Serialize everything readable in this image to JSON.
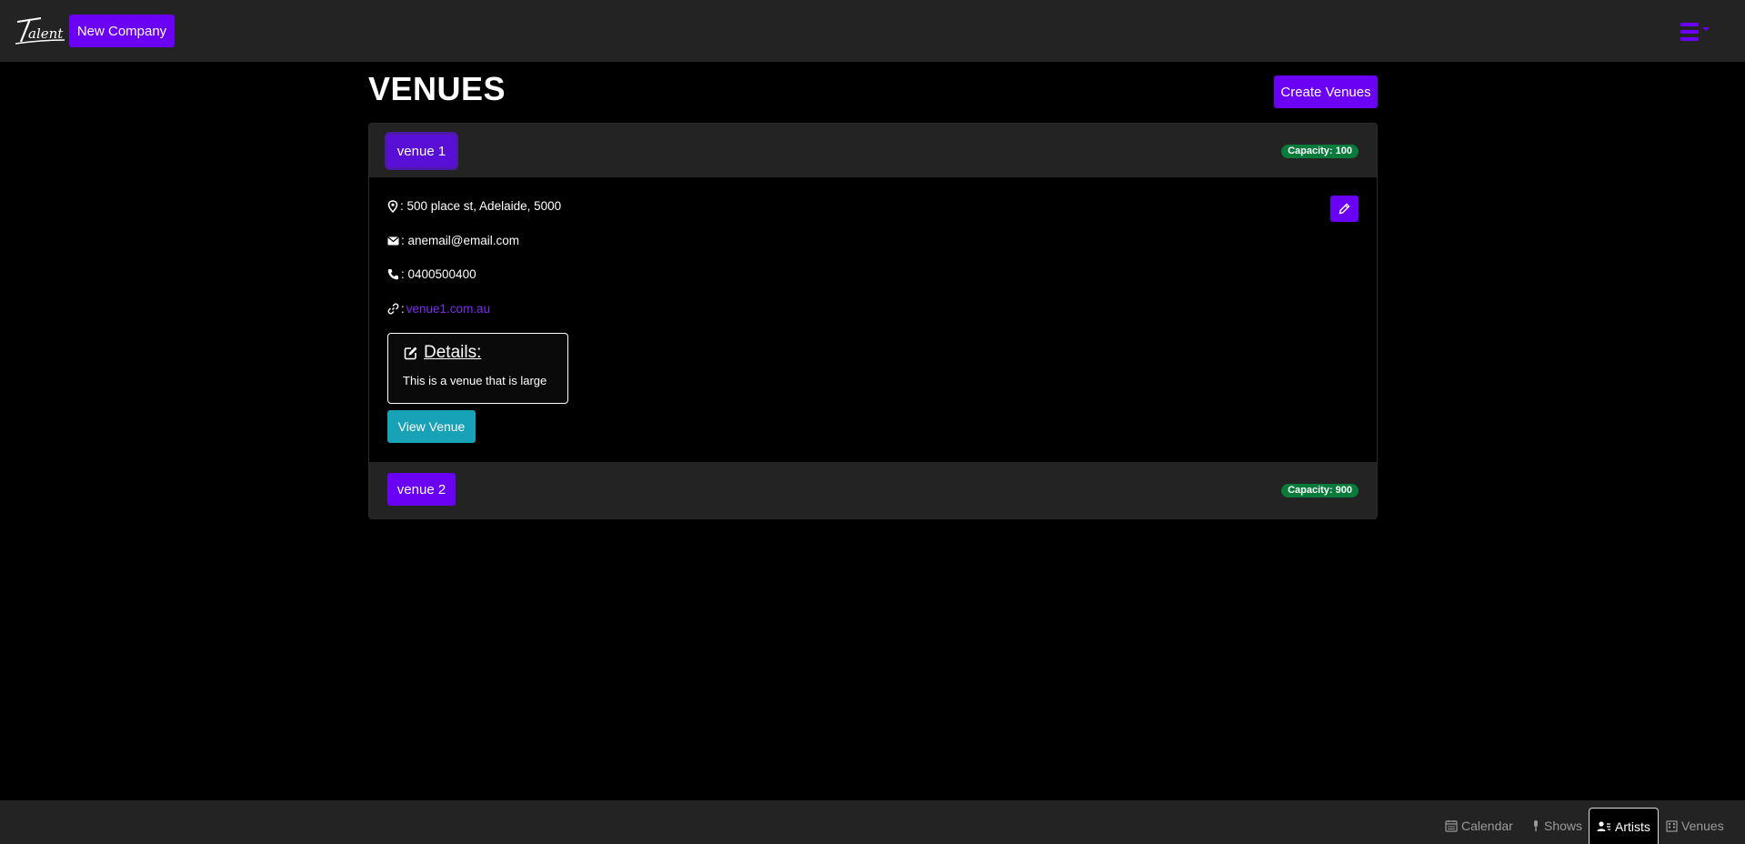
{
  "header": {
    "logo_text": "Talent",
    "new_company_label": "New Company"
  },
  "page": {
    "title": "VENUES",
    "create_label": "Create Venues"
  },
  "venues": [
    {
      "name": "venue 1",
      "capacity": "Capacity: 100",
      "address": ": 500 place st, Adelaide, 5000",
      "email": ": anemail@email.com",
      "phone": ": 0400500400",
      "website_prefix": ": ",
      "website": "venue1.com.au",
      "details_title": "Details:",
      "details_text": "This is a venue that is large",
      "view_label": "View Venue"
    },
    {
      "name": "venue 2",
      "capacity": "Capacity: 900"
    }
  ],
  "bottom_nav": [
    {
      "label": "Calendar",
      "icon": "calendar-icon"
    },
    {
      "label": "Shows",
      "icon": "mic-icon"
    },
    {
      "label": "Artists",
      "icon": "people-icon",
      "active": true
    },
    {
      "label": "Venues",
      "icon": "building-icon"
    }
  ],
  "colors": {
    "accent": "#6a00f4",
    "badge": "#087b3b",
    "info_button": "#17a2b8",
    "bar": "#232323"
  }
}
